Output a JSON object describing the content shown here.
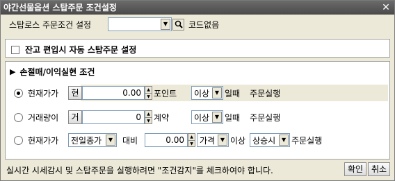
{
  "window": {
    "title": "야간선물옵션 스탑주문 조건설정",
    "close_symbol": "✕"
  },
  "code_row": {
    "label": "스탑로스 주문조건 설정",
    "code_value": "",
    "status_text": "코드없음"
  },
  "balance_panel": {
    "checkbox_label": "잔고 편입시 자동 스탑주문 설정",
    "checked": false
  },
  "section": {
    "marker": "▶",
    "title": "손절매/이익실현 조건"
  },
  "cond1": {
    "label": "현재가가",
    "type_button": "현",
    "value": "0.00",
    "unit": "포인트",
    "compare": "이상",
    "suffix": "일때",
    "action": "주문실행",
    "selected": true
  },
  "cond2": {
    "label": "거래량이",
    "type_button": "거",
    "value": "0",
    "unit": "계약",
    "compare": "이상",
    "suffix": "일때",
    "action": "주문실행",
    "selected": false
  },
  "cond3": {
    "label": "현재가가",
    "base_select": "전일종가",
    "vs_label": "대비",
    "value": "0.00",
    "unit_select": "가격",
    "compare_label": "이상",
    "direction_select": "상승시",
    "action": "주문실행",
    "selected": false
  },
  "footer": {
    "message": "실시간 시세감시 및 스탑주문을 실행하려면  \"조건감지\"를 체크하여야 합니다.",
    "ok_label": "확인",
    "cancel_label": "취소"
  },
  "colors": {
    "titlebar": "#4a4a4a",
    "dialog_bg": "#ECE9D8",
    "highlight_row": "#ECE9D8"
  }
}
